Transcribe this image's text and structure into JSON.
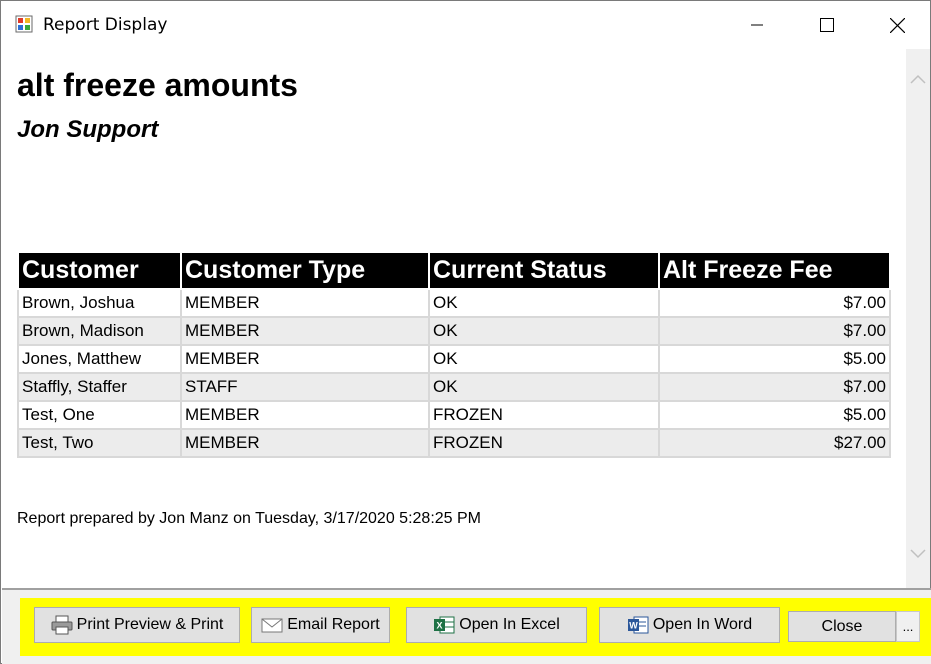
{
  "window": {
    "title": "Report Display"
  },
  "report": {
    "title": "alt freeze amounts",
    "subtitle": "Jon Support",
    "columns": [
      "Customer",
      "Customer Type",
      "Current Status",
      "Alt Freeze Fee"
    ],
    "rows": [
      {
        "customer": "Brown, Joshua",
        "type": "MEMBER",
        "status": "OK",
        "fee": "$7.00"
      },
      {
        "customer": "Brown, Madison",
        "type": "MEMBER",
        "status": "OK",
        "fee": "$7.00"
      },
      {
        "customer": "Jones, Matthew",
        "type": "MEMBER",
        "status": "OK",
        "fee": "$5.00"
      },
      {
        "customer": "Staffly, Staffer",
        "type": "STAFF",
        "status": "OK",
        "fee": "$7.00"
      },
      {
        "customer": "Test, One",
        "type": "MEMBER",
        "status": "FROZEN",
        "fee": "$5.00"
      },
      {
        "customer": "Test, Two",
        "type": "MEMBER",
        "status": "FROZEN",
        "fee": "$27.00"
      }
    ],
    "prepared": "Report prepared by Jon Manz on Tuesday, 3/17/2020 5:28:25 PM"
  },
  "buttons": {
    "print": "Print Preview & Print",
    "email": "Email Report",
    "excel": "Open In Excel",
    "word": "Open In Word",
    "close": "Close",
    "more": "..."
  },
  "icons": {
    "app": "report-app-icon",
    "print": "printer-icon",
    "email": "envelope-icon",
    "excel": "excel-icon",
    "word": "word-icon"
  },
  "colors": {
    "highlight": "#ffff00",
    "header_bg": "#000000",
    "row_alt": "#ececec"
  }
}
